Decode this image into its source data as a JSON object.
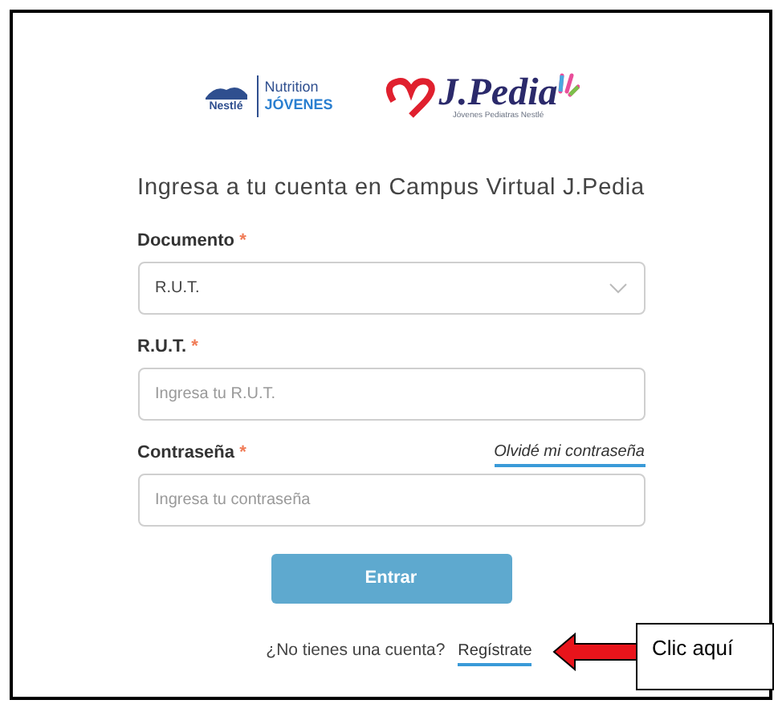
{
  "logos": {
    "nestle_name": "Nestlé",
    "nutrition": "Nutrition",
    "jovenes": "JÓVENES",
    "jpedia": "J.Pedia",
    "jpedia_tagline": "Jóvenes Pediatras Nestlé"
  },
  "title": "Ingresa a tu cuenta en Campus Virtual J.Pedia",
  "fields": [
    {
      "kind": "select",
      "label": "Documento",
      "required_mark": "*",
      "value": "R.U.T."
    },
    {
      "kind": "text",
      "label": "R.U.T.",
      "required_mark": "*",
      "placeholder": "Ingresa tu R.U.T."
    },
    {
      "kind": "text",
      "label": "Contraseña",
      "required_mark": "*",
      "placeholder": "Ingresa tu contraseña",
      "link": "Olvidé mi contraseña"
    }
  ],
  "submit_button": "Entrar",
  "signup": {
    "prompt": "¿No tienes una cuenta?",
    "link": "Regístrate"
  },
  "callout": "Clic aquí"
}
